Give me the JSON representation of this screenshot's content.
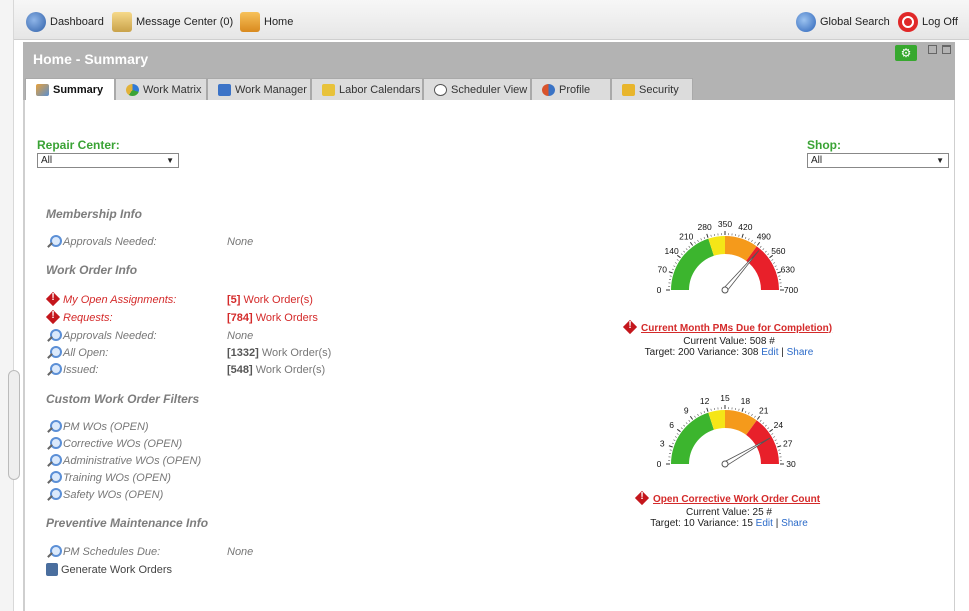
{
  "toolbar": {
    "dashboard": "Dashboard",
    "message_center": "Message Center (0)",
    "home": "Home",
    "global_search": "Global Search",
    "log_off": "Log Off"
  },
  "header": {
    "title": "Home - Summary"
  },
  "tabs": [
    {
      "label": "Summary",
      "icon": "summary-icon",
      "active": true
    },
    {
      "label": "Work Matrix",
      "icon": "work-matrix-icon"
    },
    {
      "label": "Work Manager",
      "icon": "work-manager-icon"
    },
    {
      "label": "Labor Calendars",
      "icon": "labor-calendars-icon"
    },
    {
      "label": "Scheduler View",
      "icon": "scheduler-view-icon"
    },
    {
      "label": "Profile",
      "icon": "profile-icon"
    },
    {
      "label": "Security",
      "icon": "security-icon"
    }
  ],
  "filters": {
    "repair_center_label": "Repair Center:",
    "repair_center_value": "All",
    "shop_label": "Shop:",
    "shop_value": "All"
  },
  "membership": {
    "title": "Membership Info",
    "approvals_label": "Approvals Needed:",
    "approvals_value": "None"
  },
  "work_order": {
    "title": "Work Order Info",
    "rows": [
      {
        "label": "My Open Assignments:",
        "count": "[5]",
        "text": " Work Order(s)"
      },
      {
        "label": "Requests:",
        "count": "[784]",
        "text": " Work Orders"
      },
      {
        "label": "Approvals Needed:",
        "value": "None"
      },
      {
        "label": "All Open:",
        "count": "[1332]",
        "text": " Work Order(s)"
      },
      {
        "label": "Issued:",
        "count": "[548]",
        "text": " Work Order(s)"
      }
    ]
  },
  "custom_filters": {
    "title": "Custom Work Order Filters",
    "items": [
      "PM WOs (OPEN)",
      "Corrective WOs (OPEN)",
      "Administrative WOs (OPEN)",
      "Training WOs (OPEN)",
      "Safety WOs (OPEN)"
    ]
  },
  "pm_info": {
    "title": "Preventive Maintenance Info",
    "schedules_label": "PM Schedules Due:",
    "schedules_value": "None",
    "generate_label": "Generate Work Orders"
  },
  "gauges": [
    {
      "title": "Current Month PMs Due for Completion)",
      "current": "Current Value: 508 #",
      "target": "Target: 200 Variance: 308",
      "edit": "Edit",
      "sep": "|",
      "share": "Share",
      "min": 0,
      "max": 700,
      "value": 508,
      "ticks": [
        "0",
        "70",
        "140",
        "210",
        "280",
        "350",
        "420",
        "490",
        "560",
        "630",
        "700"
      ]
    },
    {
      "title": "Open Corrective Work Order Count",
      "current": "Current Value: 25 #",
      "target": "Target: 10 Variance: 15",
      "edit": "Edit",
      "sep": "|",
      "share": "Share",
      "min": 0,
      "max": 30,
      "value": 25,
      "ticks": [
        "0",
        "3",
        "6",
        "9",
        "12",
        "15",
        "18",
        "21",
        "24",
        "27",
        "30"
      ]
    }
  ],
  "colors": {
    "green": "#3cb52e",
    "yellow": "#f5e617",
    "orange": "#f59a1b",
    "red": "#e8202a",
    "accent_green": "#3aa335",
    "alert_red": "#d42a2a",
    "link_blue": "#2c6bc9"
  }
}
